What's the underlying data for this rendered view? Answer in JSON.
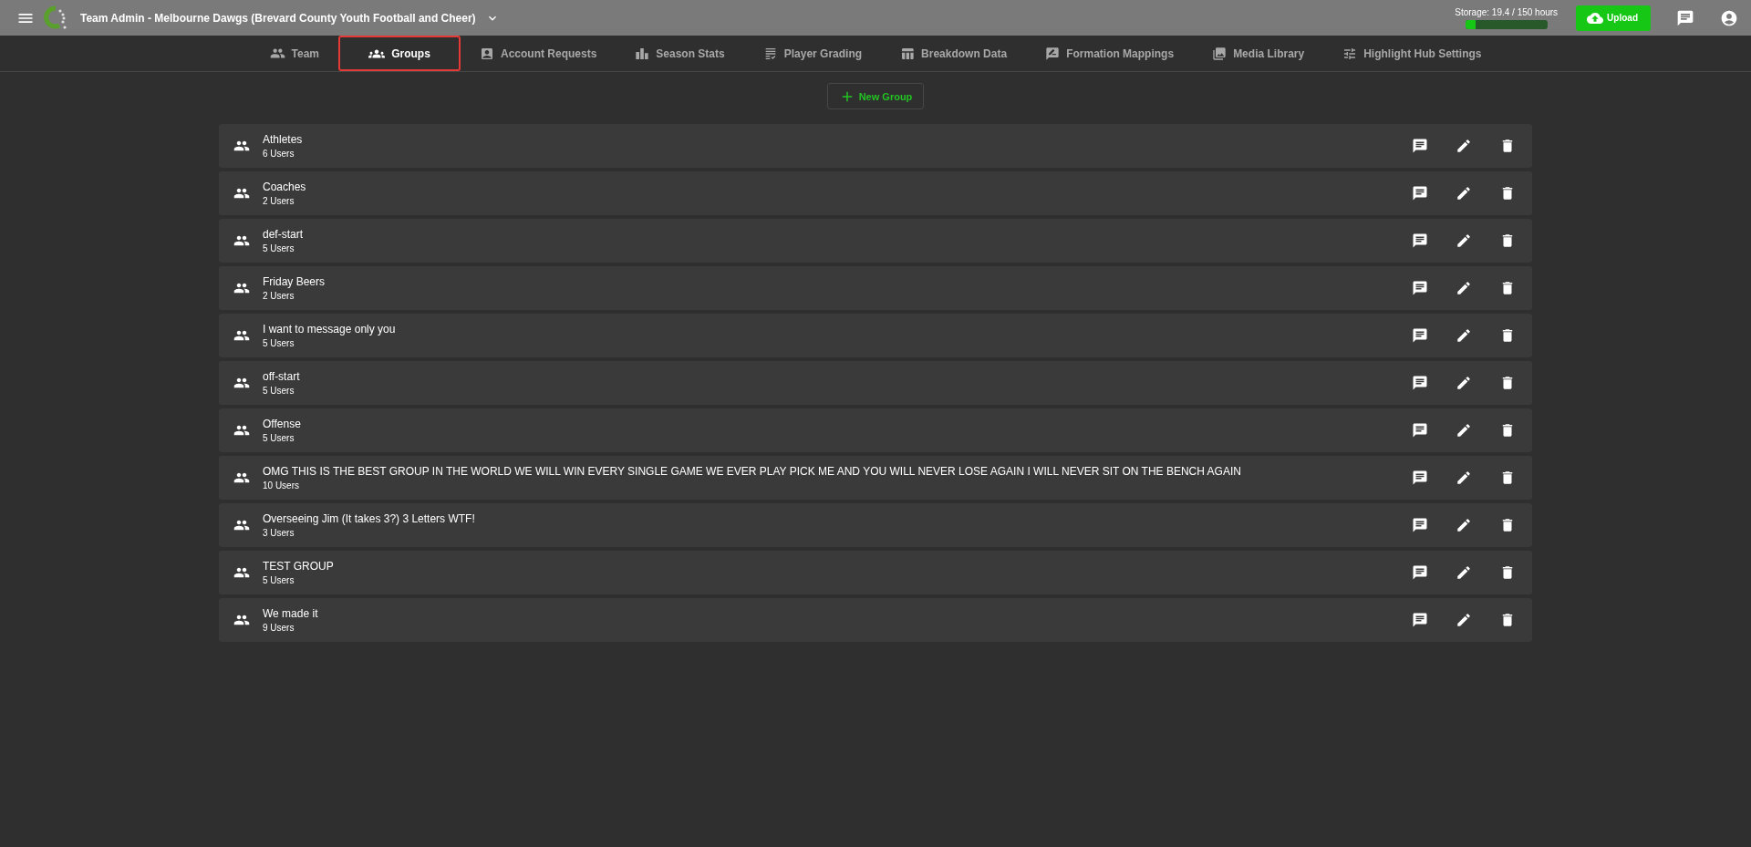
{
  "header": {
    "title": "Team Admin - Melbourne Dawgs (Brevard County Youth Football and Cheer)",
    "storage": {
      "label": "Storage: 19.4 / 150 hours",
      "level": 0.13
    },
    "upload_button": "Upload"
  },
  "tabs": [
    {
      "label": "Team",
      "selected": false
    },
    {
      "label": "Groups",
      "selected": true
    },
    {
      "label": "Account Requests",
      "selected": false
    },
    {
      "label": "Season Stats",
      "selected": false
    },
    {
      "label": "Player Grading",
      "selected": false
    },
    {
      "label": "Breakdown Data",
      "selected": false
    },
    {
      "label": "Formation Mappings",
      "selected": false
    },
    {
      "label": "Media Library",
      "selected": false
    },
    {
      "label": "Highlight Hub Settings",
      "selected": false
    }
  ],
  "new_group_button": "New Group",
  "groups": [
    {
      "name": "Athletes",
      "users": "6 Users"
    },
    {
      "name": "Coaches",
      "users": "2 Users"
    },
    {
      "name": "def-start",
      "users": "5 Users"
    },
    {
      "name": "Friday Beers",
      "users": "2 Users"
    },
    {
      "name": "I want to message only you",
      "users": "5 Users"
    },
    {
      "name": "off-start",
      "users": "5 Users"
    },
    {
      "name": "Offense",
      "users": "5 Users"
    },
    {
      "name": "OMG THIS IS THE BEST GROUP IN THE WORLD WE WILL WIN EVERY SINGLE GAME WE EVER PLAY PICK ME AND YOU WILL NEVER LOSE AGAIN I WILL NEVER SIT ON THE BENCH AGAIN",
      "users": "10 Users"
    },
    {
      "name": "Overseeing Jim (It takes 3?) 3 Letters WTF!",
      "users": "3 Users"
    },
    {
      "name": "TEST GROUP",
      "users": "5 Users"
    },
    {
      "name": "We made it",
      "users": "9 Users"
    }
  ]
}
